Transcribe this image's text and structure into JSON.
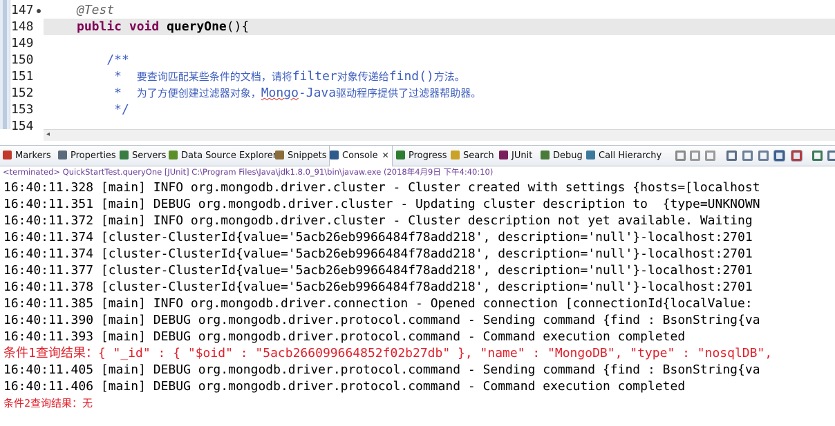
{
  "editor": {
    "lines": [
      {
        "num": "147",
        "parts": [
          {
            "t": "@Test",
            "c": "anno"
          }
        ]
      },
      {
        "num": "148",
        "parts": [
          {
            "t": "public",
            "c": "kw"
          },
          {
            "t": " "
          },
          {
            "t": "void",
            "c": "kw"
          },
          {
            "t": " "
          },
          {
            "t": "queryOne",
            "c": "bold"
          },
          {
            "t": "(){"
          }
        ]
      },
      {
        "num": "149",
        "parts": []
      },
      {
        "num": "150",
        "parts": [
          {
            "t": "    /**",
            "c": "cmt"
          }
        ]
      },
      {
        "num": "151",
        "parts": [
          {
            "t": "     *  ",
            "c": "cmt"
          },
          {
            "t": "要查询匹配某些条件的文档，请将",
            "c": "cmt zh"
          },
          {
            "t": "filter",
            "c": "cmt"
          },
          {
            "t": "对象传递给",
            "c": "cmt zh"
          },
          {
            "t": "find()",
            "c": "cmt"
          },
          {
            "t": "方法。",
            "c": "cmt zh"
          }
        ]
      },
      {
        "num": "152",
        "parts": [
          {
            "t": "     *  ",
            "c": "cmt"
          },
          {
            "t": "为了方便创建过滤器对象，",
            "c": "cmt zh"
          },
          {
            "t": "Mongo",
            "c": "cmt squiggle"
          },
          {
            "t": "-Java",
            "c": "cmt"
          },
          {
            "t": "驱动程序提供了过滤器帮助器。",
            "c": "cmt zh"
          }
        ]
      },
      {
        "num": "153",
        "parts": [
          {
            "t": "     */",
            "c": "cmt"
          }
        ]
      },
      {
        "num": "154",
        "parts": []
      }
    ],
    "scroll_left_arrow": "◂"
  },
  "tabs": [
    {
      "label": "Markers",
      "icon": "markers-icon",
      "color": "#c0392b"
    },
    {
      "label": "Properties",
      "icon": "properties-icon",
      "color": "#5b6b7a"
    },
    {
      "label": "Servers",
      "icon": "servers-icon",
      "color": "#3a7d44"
    },
    {
      "label": "Data Source Explorer",
      "icon": "data-source-icon",
      "color": "#5a8f2a"
    },
    {
      "label": "Snippets",
      "icon": "snippets-icon",
      "color": "#8a6d3b"
    },
    {
      "label": "Console",
      "icon": "console-icon",
      "color": "#2f5b8c",
      "active": true,
      "close": "✕"
    },
    {
      "label": "Progress",
      "icon": "progress-icon",
      "color": "#2e7d32"
    },
    {
      "label": "Search",
      "icon": "search-icon",
      "color": "#c9a227"
    },
    {
      "label": "JUnit",
      "icon": "junit-icon",
      "color": "#7a1f5c"
    },
    {
      "label": "Debug",
      "icon": "debug-icon",
      "color": "#4a7b3a"
    },
    {
      "label": "Call Hierarchy",
      "icon": "call-hierarchy-icon",
      "color": "#3b7a9c"
    }
  ],
  "toolbar_icons": [
    {
      "name": "terminate-icon",
      "color": "#8a8a8a"
    },
    {
      "name": "remove-launch-icon",
      "color": "#9a9a9a"
    },
    {
      "name": "remove-all-terminated-icon",
      "color": "#9a9a9a"
    },
    {
      "name": "clear-console-icon",
      "color": "#5b6e85"
    },
    {
      "name": "scroll-lock-icon",
      "color": "#6b7f98"
    },
    {
      "name": "word-wrap-icon",
      "color": "#6b7f98"
    },
    {
      "name": "pin-console-icon",
      "color": "#3d5f8a",
      "pressed": true
    },
    {
      "name": "show-on-output-icon",
      "color": "#b83a3a",
      "pressed": true
    },
    {
      "name": "open-console-icon",
      "color": "#3d7a5a"
    },
    {
      "name": "display-console-icon",
      "color": "#55708f"
    }
  ],
  "console": {
    "header": "<terminated> QuickStartTest.queryOne [JUnit] C:\\Program Files\\Java\\jdk1.8.0_91\\bin\\javaw.exe (2018年4月9日 下午4:40:10)",
    "lines": [
      {
        "text": "16:40:11.328 [main] INFO org.mongodb.driver.cluster - Cluster created with settings {hosts=[localhost",
        "err": false
      },
      {
        "text": "16:40:11.351 [main] DEBUG org.mongodb.driver.cluster - Updating cluster description to  {type=UNKNOWN",
        "err": false
      },
      {
        "text": "16:40:11.372 [main] INFO org.mongodb.driver.cluster - Cluster description not yet available. Waiting",
        "err": false
      },
      {
        "text": "16:40:11.374 [cluster-ClusterId{value='5acb26eb9966484f78add218', description='null'}-localhost:2701",
        "err": false
      },
      {
        "text": "16:40:11.374 [cluster-ClusterId{value='5acb26eb9966484f78add218', description='null'}-localhost:2701",
        "err": false
      },
      {
        "text": "16:40:11.377 [cluster-ClusterId{value='5acb26eb9966484f78add218', description='null'}-localhost:2701",
        "err": false
      },
      {
        "text": "16:40:11.378 [cluster-ClusterId{value='5acb26eb9966484f78add218', description='null'}-localhost:2701",
        "err": false
      },
      {
        "text": "16:40:11.385 [main] INFO org.mongodb.driver.connection - Opened connection [connectionId{localValue:",
        "err": false
      },
      {
        "text": "16:40:11.390 [main] DEBUG org.mongodb.driver.protocol.command - Sending command {find : BsonString{va",
        "err": false
      },
      {
        "text": "16:40:11.393 [main] DEBUG org.mongodb.driver.protocol.command - Command execution completed",
        "err": false
      },
      {
        "text": "条件1查询结果：{ \"_id\" : { \"$oid\" : \"5acb266099664852f02b27db\" }, \"name\" : \"MongoDB\", \"type\" : \"nosqlDB\",",
        "err": true
      },
      {
        "text": "16:40:11.405 [main] DEBUG org.mongodb.driver.protocol.command - Sending command {find : BsonString{va",
        "err": false
      },
      {
        "text": "16:40:11.406 [main] DEBUG org.mongodb.driver.protocol.command - Command execution completed",
        "err": false
      },
      {
        "text": "条件2查询结果：无",
        "err": true,
        "zh": true
      }
    ]
  }
}
